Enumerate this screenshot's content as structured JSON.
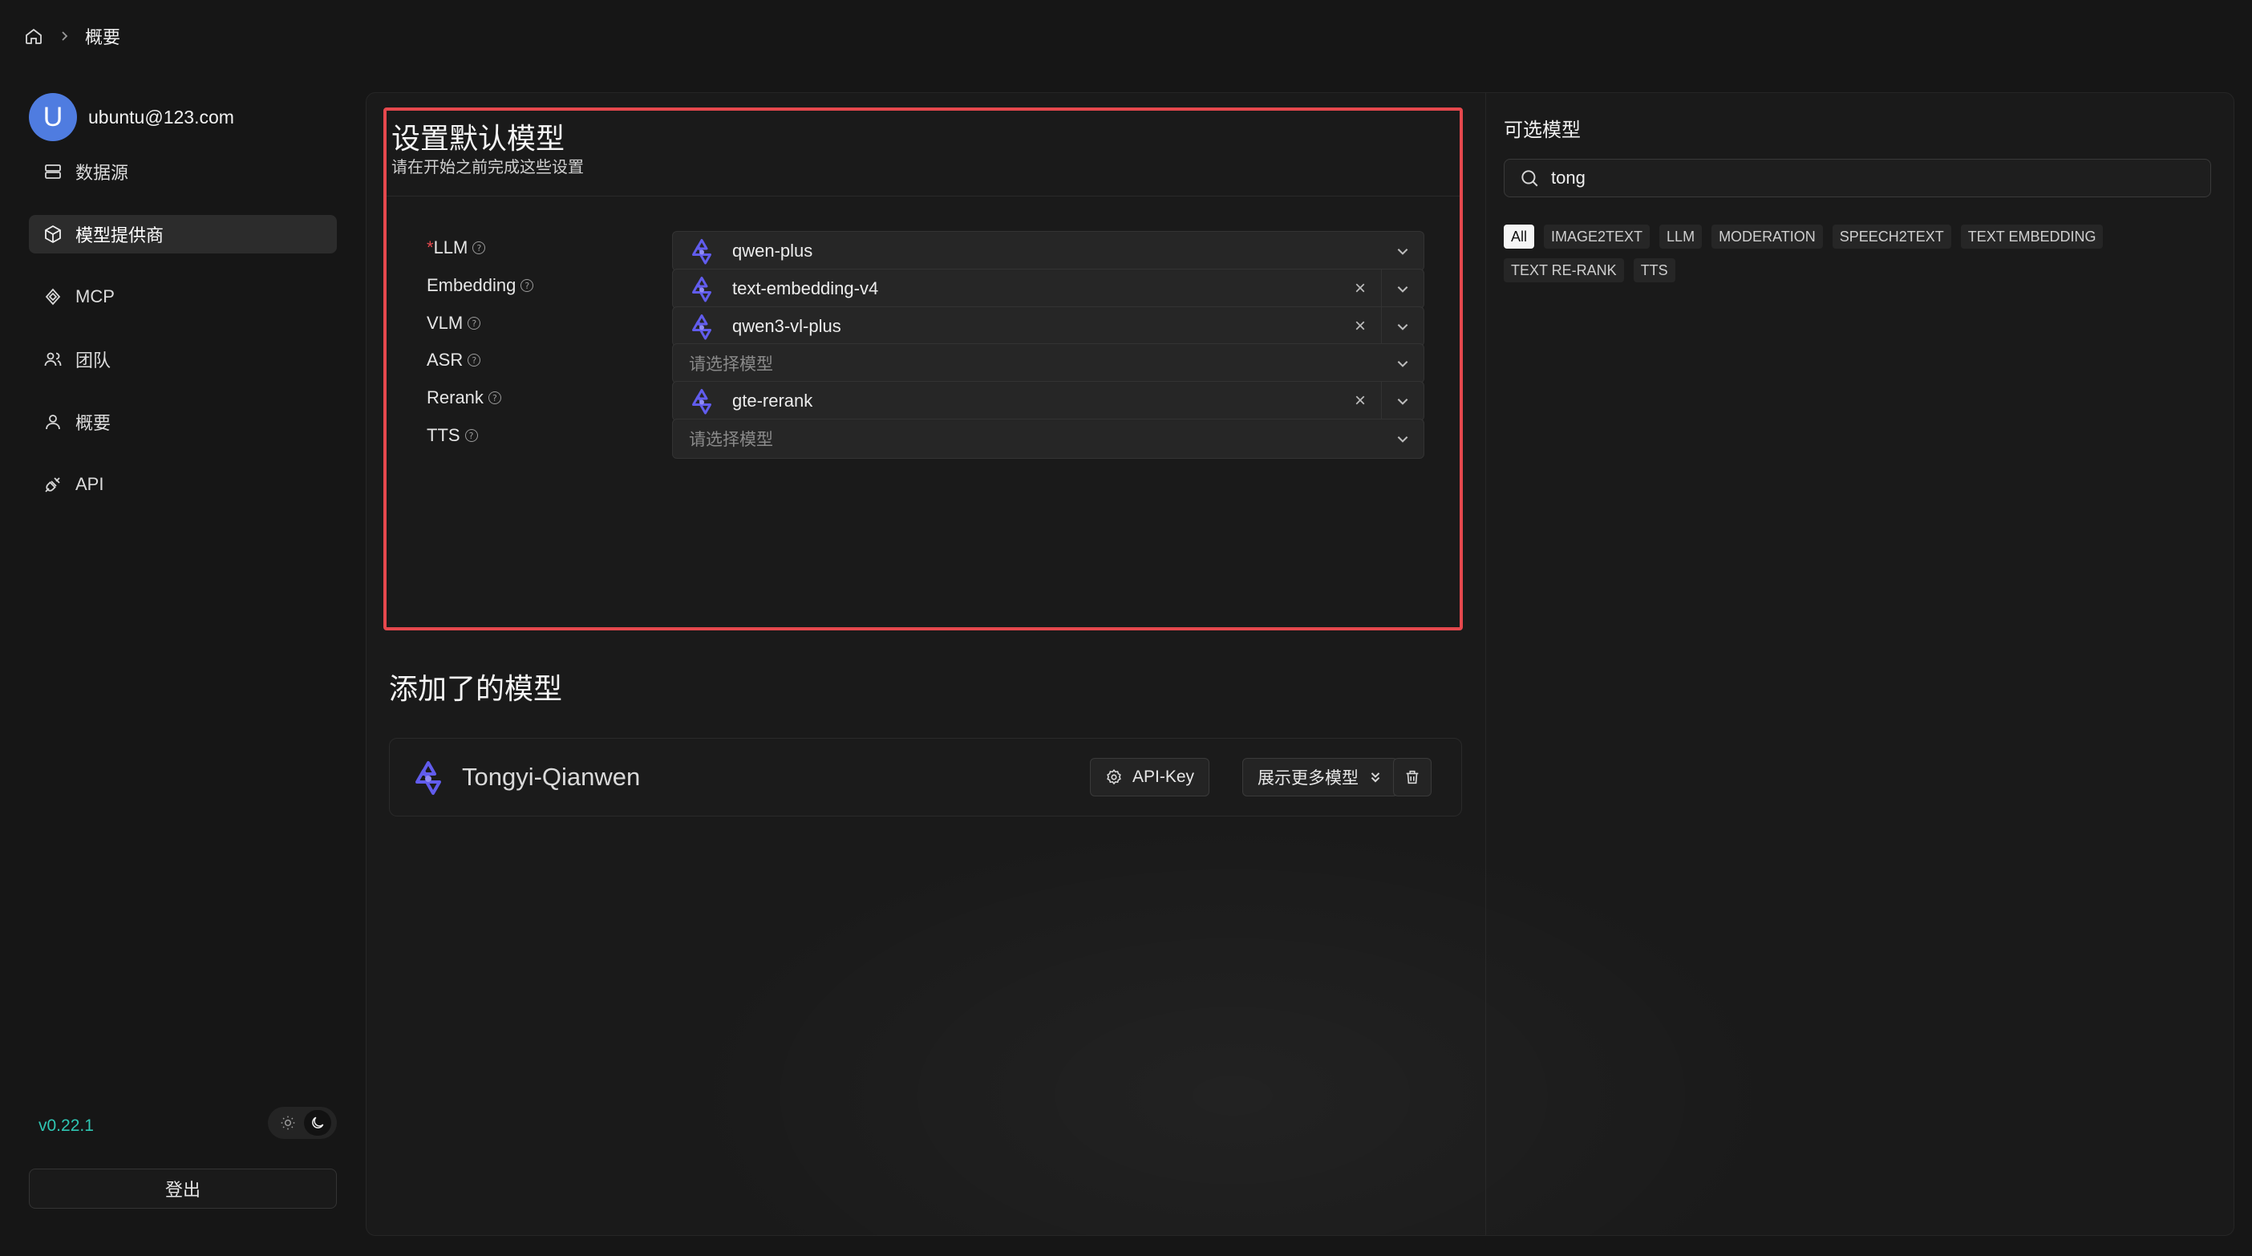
{
  "breadcrumb": {
    "current": "概要"
  },
  "user": {
    "avatar_letter": "U",
    "email": "ubuntu@123.com"
  },
  "sidebar": {
    "items": [
      {
        "label": "数据源",
        "icon": "database-icon"
      },
      {
        "label": "模型提供商",
        "icon": "cube-icon",
        "active": true
      },
      {
        "label": "MCP",
        "icon": "mcp-icon"
      },
      {
        "label": "团队",
        "icon": "team-icon"
      },
      {
        "label": "概要",
        "icon": "user-icon"
      },
      {
        "label": "API",
        "icon": "api-icon"
      }
    ],
    "version": "v0.22.1",
    "logout": "登出"
  },
  "defaults": {
    "title": "设置默认模型",
    "subtitle": "请在开始之前完成这些设置",
    "rows": [
      {
        "label": "LLM",
        "required": true,
        "value": "qwen-plus",
        "placeholder": ""
      },
      {
        "label": "Embedding",
        "required": false,
        "value": "text-embedding-v4",
        "placeholder": ""
      },
      {
        "label": "VLM",
        "required": false,
        "value": "qwen3-vl-plus",
        "placeholder": ""
      },
      {
        "label": "ASR",
        "required": false,
        "value": "",
        "placeholder": "请选择模型"
      },
      {
        "label": "Rerank",
        "required": false,
        "value": "gte-rerank",
        "placeholder": ""
      },
      {
        "label": "TTS",
        "required": false,
        "value": "",
        "placeholder": "请选择模型"
      }
    ]
  },
  "added": {
    "title": "添加了的模型",
    "provider": {
      "name": "Tongyi-Qianwen",
      "api_key_label": "API-Key",
      "more_label": "展示更多模型"
    }
  },
  "available": {
    "title": "可选模型",
    "search_value": "tong",
    "tags": [
      "All",
      "IMAGE2TEXT",
      "LLM",
      "MODERATION",
      "SPEECH2TEXT",
      "TEXT EMBEDDING",
      "TEXT RE-RANK",
      "TTS"
    ]
  },
  "colors": {
    "accent_red": "#e5484d",
    "version_teal": "#2fc6b3",
    "brand_purple": "#615ced"
  }
}
